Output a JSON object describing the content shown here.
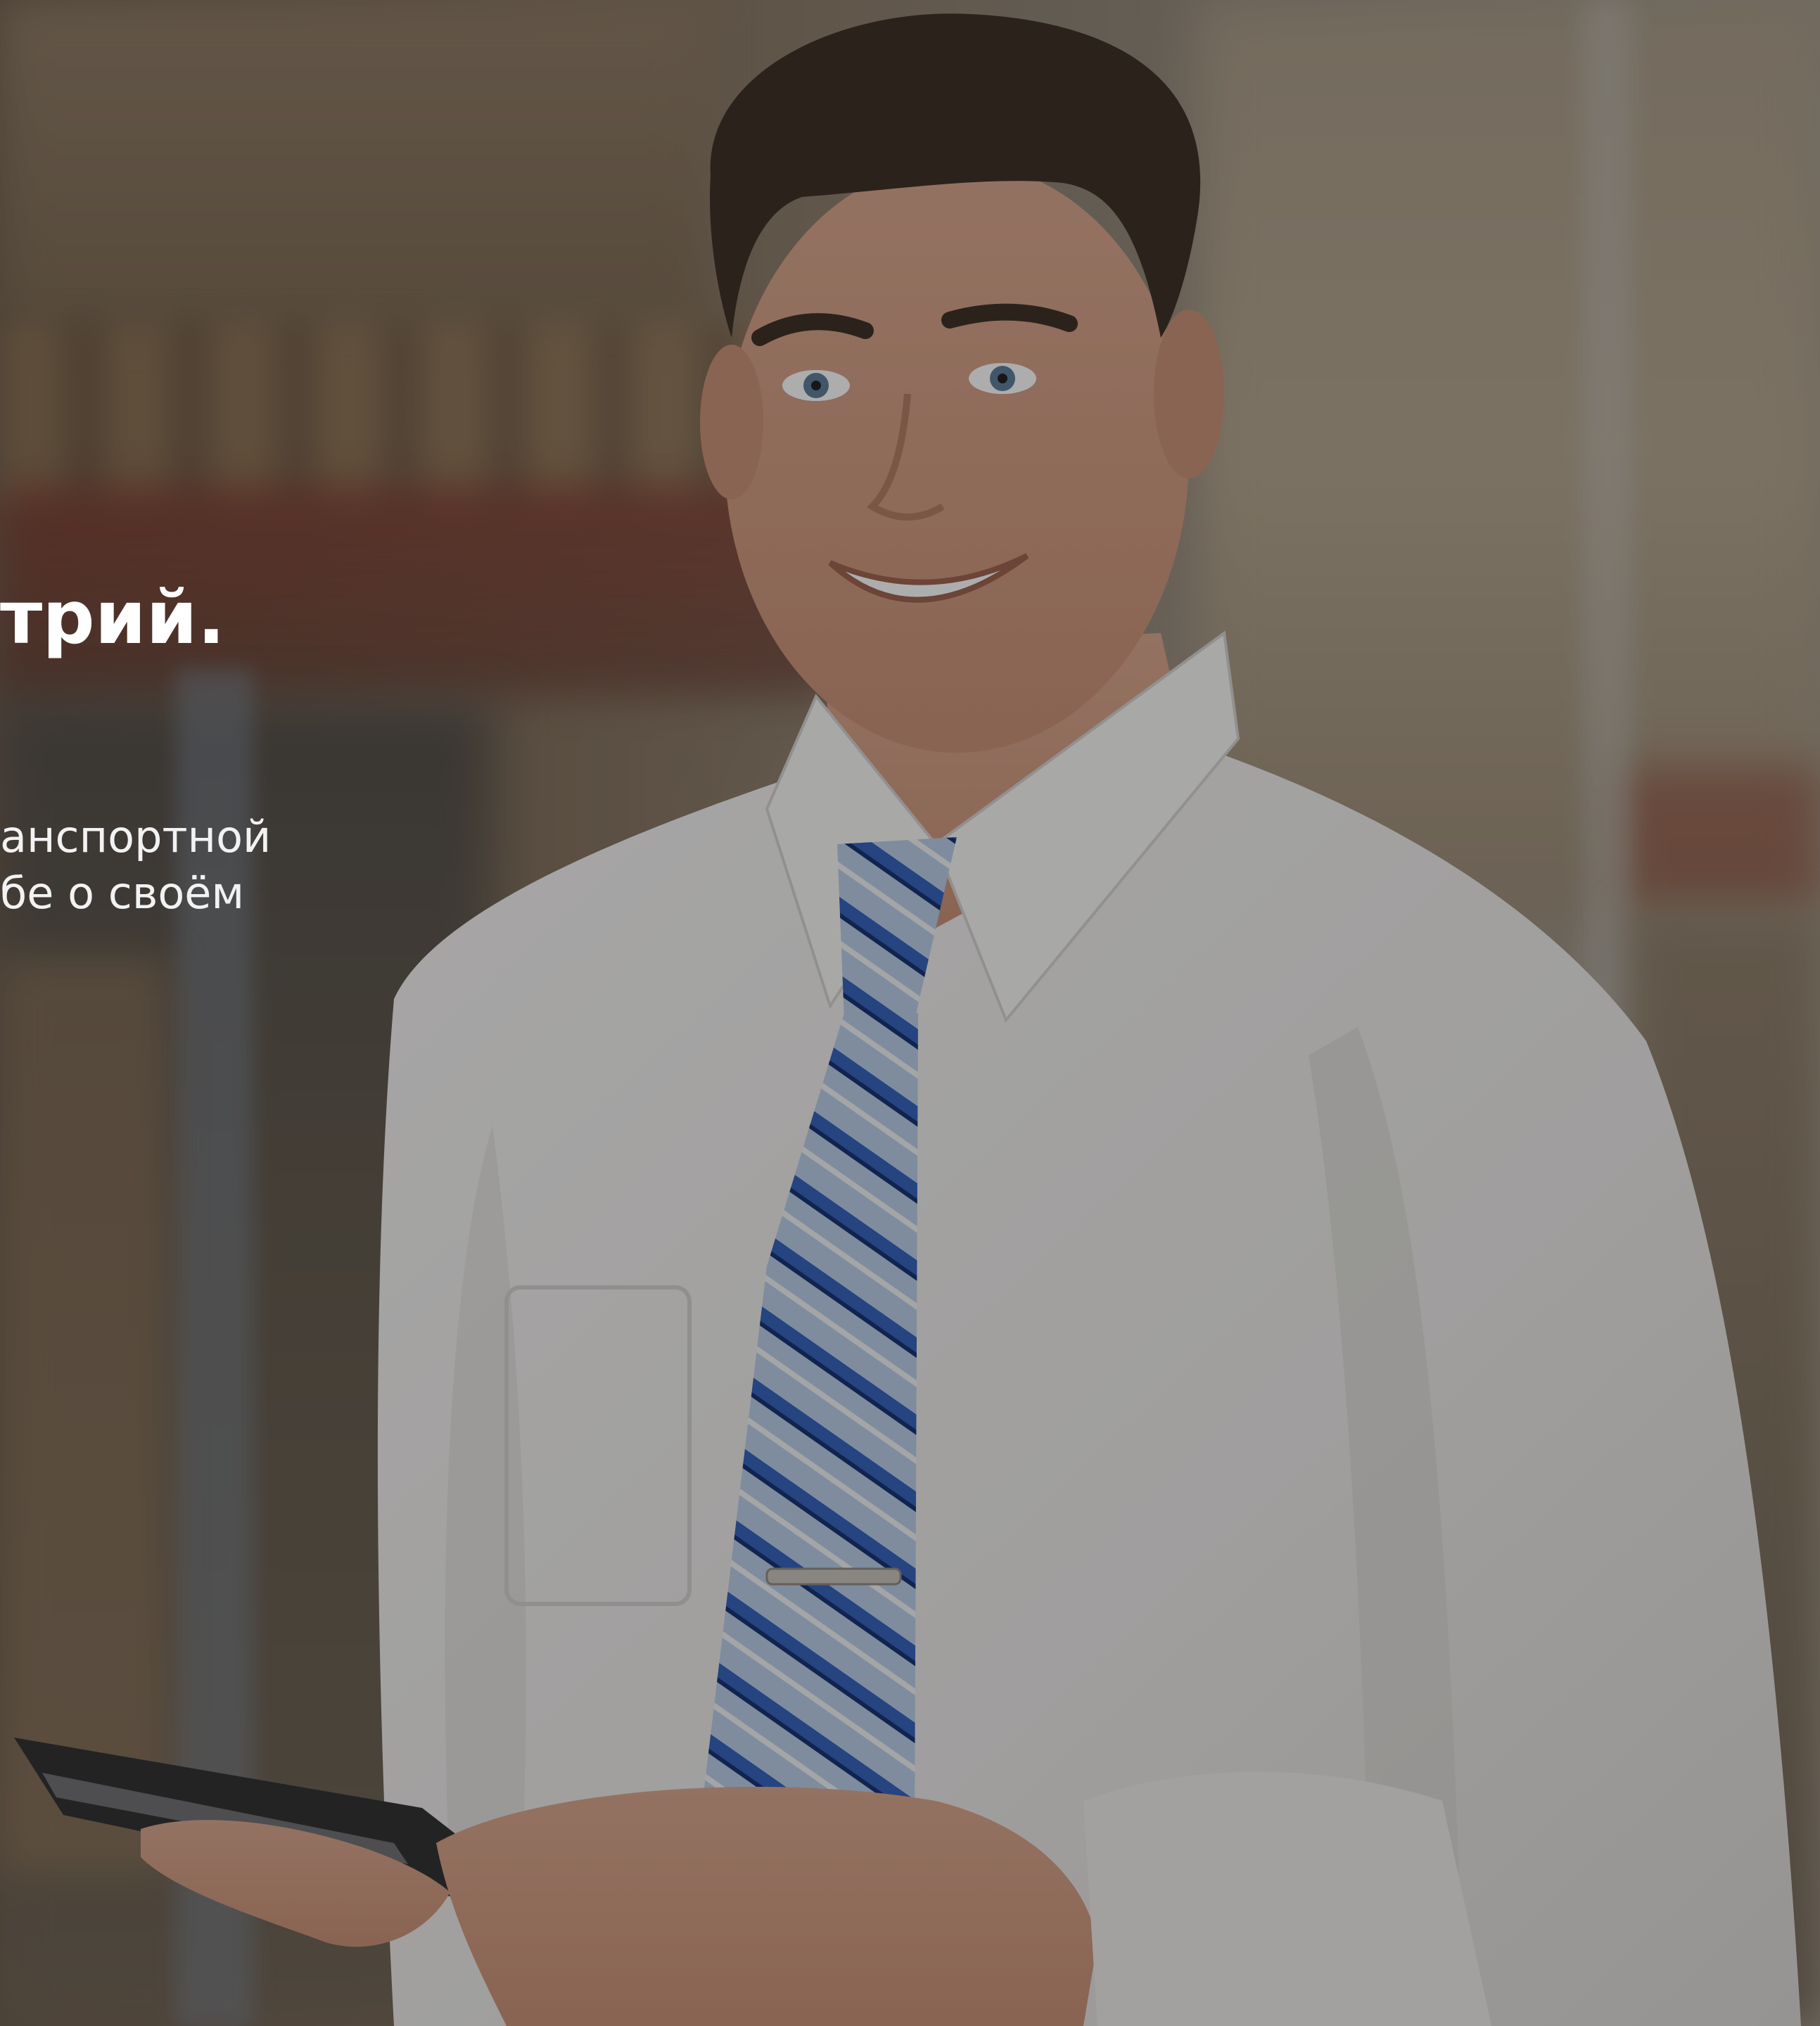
{
  "hero": {
    "headline": "трий.",
    "subtext_line1": "анспортной",
    "subtext_line2": "бе о своём"
  },
  "colors": {
    "overlay": "#141416",
    "text": "#ffffff",
    "tie_blue": "#2f5fb8",
    "shirt": "#f4f3f1"
  }
}
